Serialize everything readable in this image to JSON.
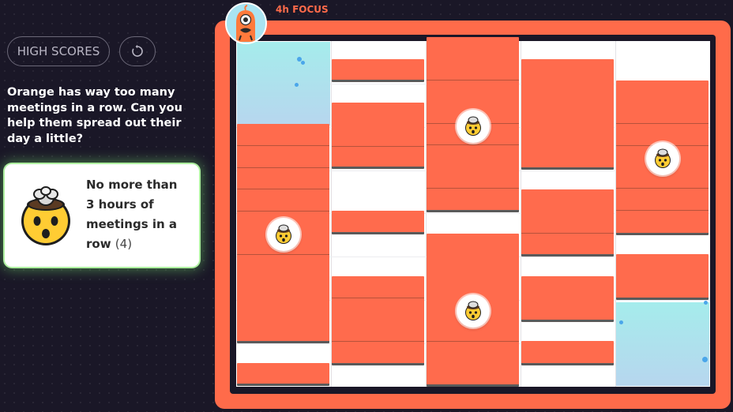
{
  "toolbar": {
    "high_scores_label": "HIGH SCORES",
    "restart_icon": "restart-icon"
  },
  "puzzle": {
    "description": "Orange has way too many meetings in a row. Can you help them spread out their day a little?"
  },
  "rule": {
    "icon": "mind-blown-emoji-icon",
    "text": "No more than 3 hours of meetings in a row",
    "count": "(4)"
  },
  "board": {
    "header_label": "4h FOCUS",
    "avatar_icon": "orange-one-eyed-monster-avatar-icon",
    "stress_icon": "mind-blown-emoji-icon",
    "colors": {
      "frame": "#ff6b4a",
      "meeting": "#ff6b4d",
      "focus": "#a5ecec",
      "background": "#1a1727",
      "rule_glow": "#aef0a0"
    }
  }
}
